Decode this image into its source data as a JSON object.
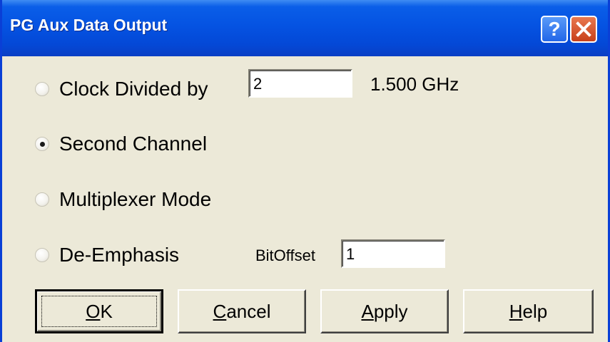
{
  "window": {
    "title": "PG Aux Data Output",
    "help_glyph": "?",
    "colors": {
      "titlebar": "#0553e2",
      "face": "#ece9d8",
      "close": "#c8401a"
    }
  },
  "options": [
    {
      "label": "Clock Divided by",
      "checked": false
    },
    {
      "label": "Second Channel",
      "checked": true
    },
    {
      "label": "Multiplexer Mode",
      "checked": false
    },
    {
      "label": "De-Emphasis",
      "checked": false
    }
  ],
  "clock": {
    "divisor_value": "2",
    "frequency_text": "1.500 GHz"
  },
  "deemphasis": {
    "bitoffset_label": "BitOffset",
    "bitoffset_value": "1"
  },
  "buttons": {
    "ok": {
      "mnemonic": "O",
      "rest": "K"
    },
    "cancel": {
      "mnemonic": "C",
      "rest": "ancel"
    },
    "apply": {
      "mnemonic": "A",
      "rest": "pply"
    },
    "help": {
      "mnemonic": "H",
      "rest": "elp"
    }
  },
  "icons": {
    "help": "help-question-icon",
    "close": "close-x-icon"
  }
}
